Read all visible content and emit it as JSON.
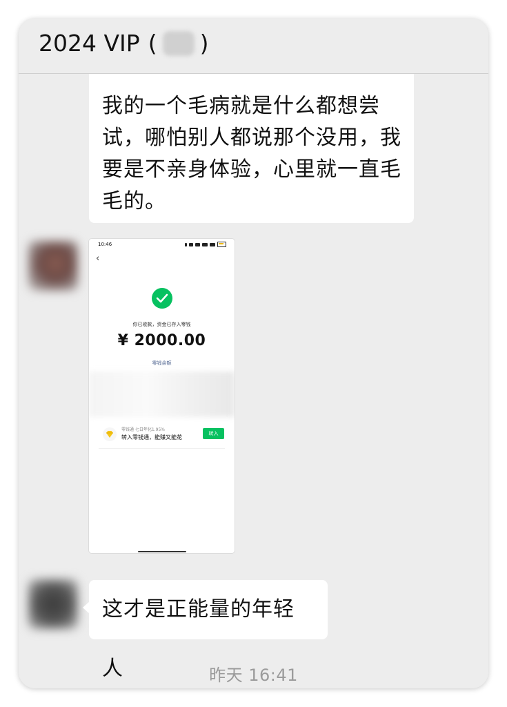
{
  "header": {
    "title_prefix": "2024 VIP",
    "paren_open": "(",
    "paren_close": ")"
  },
  "messages": [
    {
      "type": "text",
      "text": "我的一个毛病就是什么都想尝试，哪怕别人都说那个没用，我要是不亲身体验，心里就一直毛毛的。"
    },
    {
      "type": "image",
      "screenshot": {
        "status_time": "10:46",
        "received_text": "你已收款，资金已存入零钱",
        "amount": "¥ 2000.00",
        "balance_link": "零钱余额",
        "lqt_subtitle": "零钱通 七日年化1.95%",
        "lqt_title": "转入零钱通，能赚又能花",
        "lqt_button": "转入",
        "accent_color": "#07c160"
      }
    },
    {
      "type": "text",
      "text": "这才是正能量的年轻人"
    }
  ],
  "timestamp": "昨天 16:41"
}
